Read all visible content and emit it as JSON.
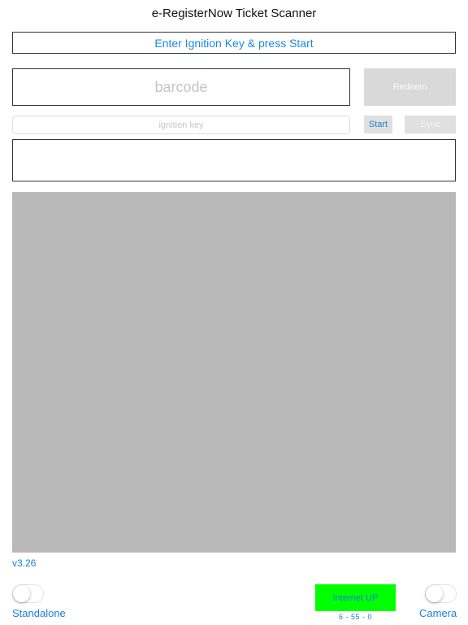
{
  "header": {
    "title": "e-RegisterNow Ticket Scanner",
    "status_message": "Enter Ignition Key & press Start"
  },
  "barcode": {
    "value": "",
    "placeholder": "barcode"
  },
  "buttons": {
    "redeem_label": "Redeem",
    "start_label": "Start",
    "sync_label": "Sync"
  },
  "ignition_key": {
    "value": "",
    "placeholder": "ignition key"
  },
  "message_box": {
    "text": ""
  },
  "footer": {
    "version": "v3.26",
    "standalone_label": "Standalone",
    "standalone_on": false,
    "camera_label": "Camera",
    "camera_on": false,
    "internet_status": "Internet UP",
    "counts": "6 - 55 - 0"
  },
  "colors": {
    "accent": "#1a7fd9",
    "internet_up": "#00ff00",
    "camera_area": "#b9b9b9",
    "disabled_button": "#d9d9d9"
  }
}
